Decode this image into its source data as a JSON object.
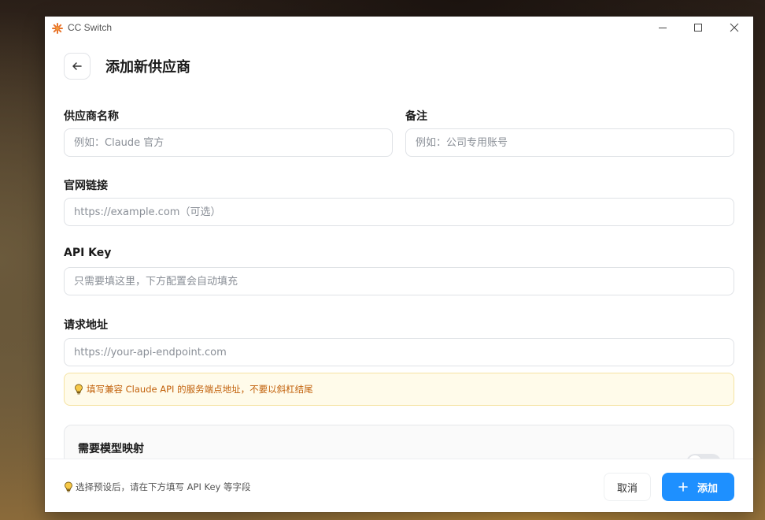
{
  "window": {
    "app_title": "CC Switch"
  },
  "header": {
    "title": "添加新供应商"
  },
  "form": {
    "provider_name": {
      "label": "供应商名称",
      "placeholder": "例如：Claude 官方"
    },
    "notes": {
      "label": "备注",
      "placeholder": "例如：公司专用账号"
    },
    "website": {
      "label": "官网链接",
      "placeholder": "https://example.com（可选）"
    },
    "api_key": {
      "label": "API Key",
      "placeholder": "只需要填这里，下方配置会自动填充"
    },
    "endpoint": {
      "label": "请求地址",
      "placeholder": "https://your-api-endpoint.com"
    },
    "endpoint_hint": "填写兼容 Claude API 的服务端点地址，不要以斜杠结尾",
    "model_mapping": {
      "label": "需要模型映射",
      "enabled": false
    }
  },
  "footer": {
    "hint": "选择预设后，请在下方填写 API Key 等字段",
    "cancel_label": "取消",
    "add_label": "添加"
  },
  "colors": {
    "accent": "#1e90ff",
    "hint_text": "#c2610b",
    "hint_bg": "#fffbea"
  },
  "icons": {
    "app": "starburst-icon",
    "back": "arrow-left-icon",
    "hint": "lightbulb-icon",
    "add": "plus-icon"
  }
}
